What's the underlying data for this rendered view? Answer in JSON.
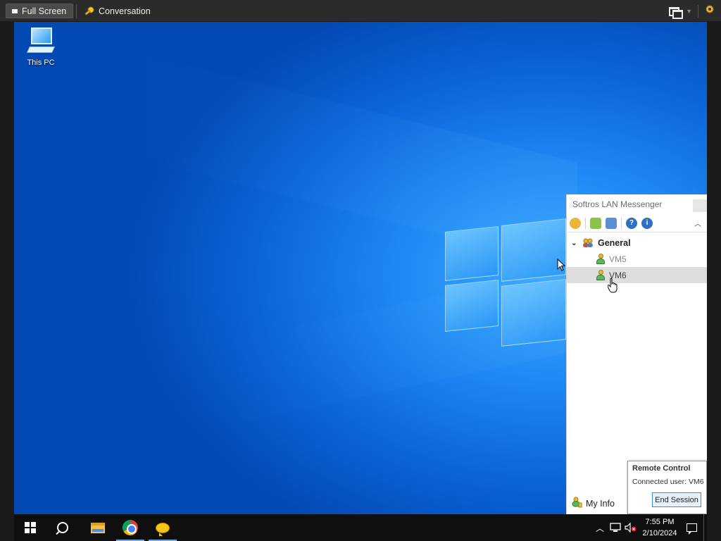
{
  "toolbar": {
    "fullscreen_label": "Full Screen",
    "conversation_label": "Conversation",
    "icons": [
      "window-mode-icon",
      "dropdown-icon",
      "settings-gear-icon"
    ]
  },
  "desktop": {
    "icon_label": "This PC"
  },
  "messenger": {
    "title": "Softros LAN Messenger",
    "group_name": "General",
    "users": [
      {
        "name": "VM5",
        "selected": false
      },
      {
        "name": "VM6",
        "selected": true
      }
    ],
    "my_info_label": "My Info"
  },
  "remote_control": {
    "title": "Remote Control",
    "connected_user": "Connected user:  VM6",
    "end_session_label": "End Session"
  },
  "taskbar": {
    "time": "7:55 PM",
    "date": "2/10/2024",
    "accent": "#7aa7d9"
  }
}
